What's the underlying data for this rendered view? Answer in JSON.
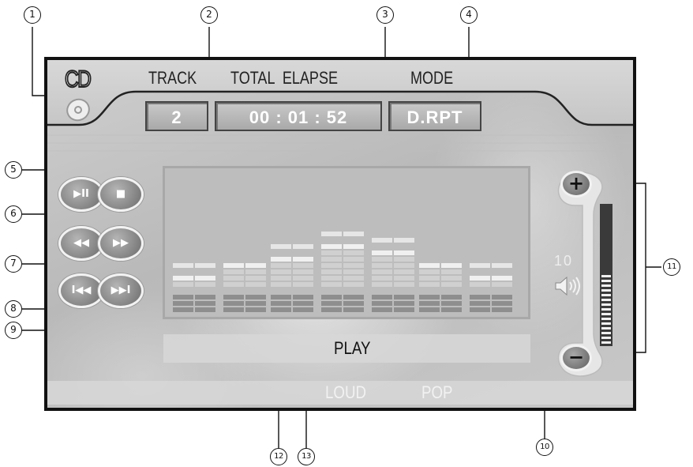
{
  "header": {
    "cd_logo": "CD",
    "track_label": "TRACK",
    "total_elapse_label": "TOTAL  ELAPSE",
    "mode_label": "MODE"
  },
  "display": {
    "track_value": "2",
    "time_value": "00 : 01 : 52",
    "mode_value": "D.RPT"
  },
  "controls": {
    "play_pause_icon": "play-pause-icon",
    "stop_icon": "stop-icon",
    "rewind_icon": "rewind-icon",
    "fast_forward_icon": "fast-forward-icon",
    "previous_icon": "skip-previous-icon",
    "next_icon": "skip-next-icon"
  },
  "equalizer": {
    "band_levels": [
      2,
      4,
      5,
      7,
      6,
      4,
      2
    ],
    "band_peaks": [
      1,
      0,
      1,
      1,
      1,
      0,
      1
    ],
    "max_level": 7
  },
  "volume": {
    "level_text": "10",
    "level_fraction": 0.5,
    "plus_label": "+",
    "minus_label": "−",
    "speaker_icon": "speaker-icon"
  },
  "status": {
    "play_text": "PLAY",
    "loud_text": "LOUD",
    "pop_text": "POP"
  },
  "callouts": {
    "c1": "①",
    "c2": "②",
    "c3": "③",
    "c4": "④",
    "c5": "⑤",
    "c6": "⑥",
    "c7": "⑦",
    "c8": "⑧",
    "c9": "⑨",
    "c10": "⑩",
    "c11": "⑪",
    "c12": "⑫",
    "c13": "⑬"
  }
}
